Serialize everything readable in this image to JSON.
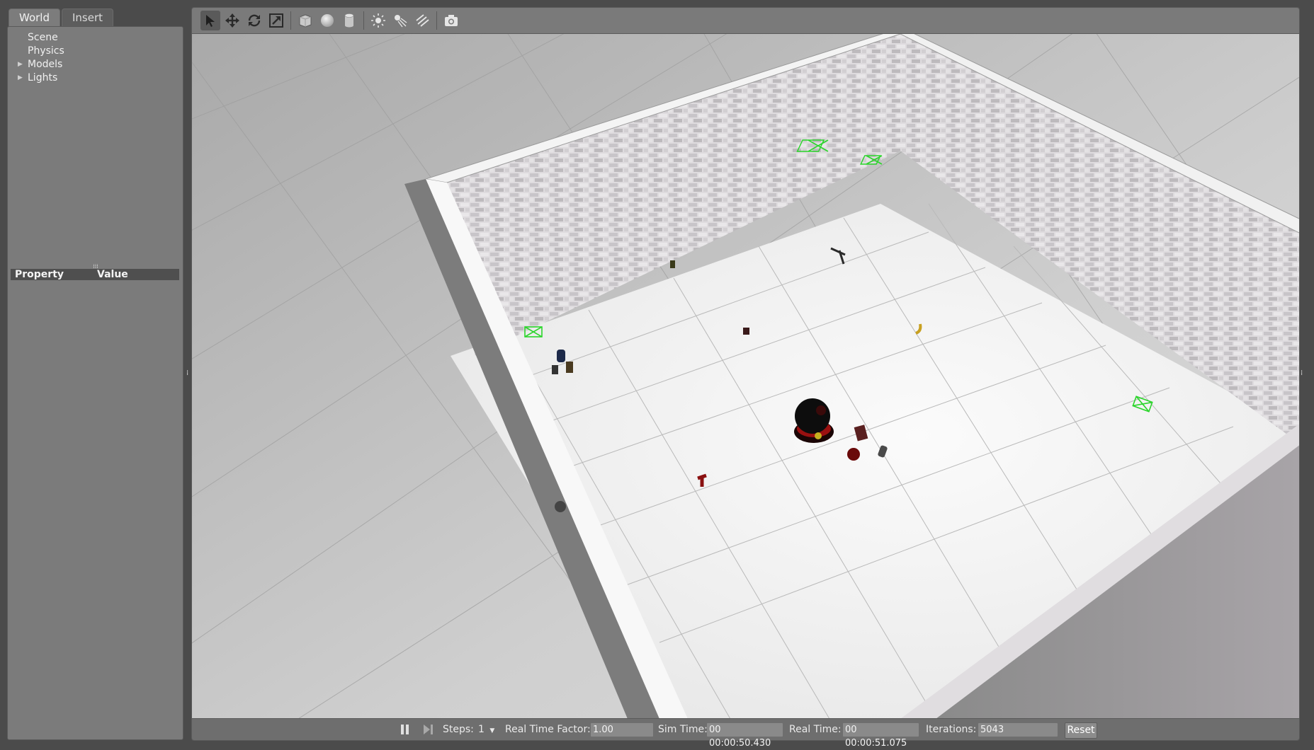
{
  "tabs": [
    {
      "label": "World",
      "active": true
    },
    {
      "label": "Insert",
      "active": false
    }
  ],
  "world_tree": [
    {
      "label": "Scene",
      "expandable": false
    },
    {
      "label": "Physics",
      "expandable": false
    },
    {
      "label": "Models",
      "expandable": true
    },
    {
      "label": "Lights",
      "expandable": true
    }
  ],
  "properties": {
    "col_property": "Property",
    "col_value": "Value"
  },
  "toolbar": {
    "tools": [
      "select-mode-icon",
      "translate-mode-icon",
      "rotate-mode-icon",
      "scale-mode-icon",
      "box-shape-icon",
      "sphere-shape-icon",
      "cylinder-shape-icon",
      "point-light-icon",
      "spot-light-icon",
      "directional-light-icon",
      "screenshot-icon"
    ]
  },
  "status": {
    "steps_label": "Steps:",
    "steps_value": "1",
    "rtf_label": "Real Time Factor:",
    "rtf_value": "1.00",
    "sim_time_label": "Sim Time:",
    "sim_time_value": "00 00:00:50.430",
    "real_time_label": "Real Time:",
    "real_time_value": "00 00:00:51.075",
    "iterations_label": "Iterations:",
    "iterations_value": "5043",
    "reset_label": "Reset"
  },
  "colors": {
    "panel_bg": "#7b7b7b",
    "floor": "#f2f2f2",
    "ground": "#c6c6c6",
    "wall": "#d9d6d9",
    "marker": "#27d327"
  }
}
